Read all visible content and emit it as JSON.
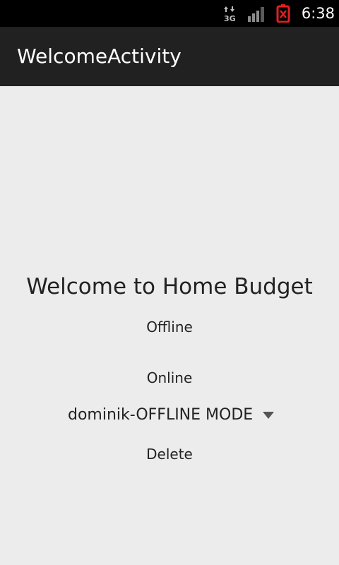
{
  "status_bar": {
    "network_icon": "3g-data-icon",
    "signal_icon": "signal-strength-icon",
    "battery_icon": "battery-empty-icon",
    "battery_color": "#e02020",
    "time": "6:38"
  },
  "action_bar": {
    "title": "WelcomeActivity",
    "background": "#212121"
  },
  "main": {
    "welcome_text": "Welcome to Home Budget",
    "offline_button": "Offline",
    "online_button": "Online",
    "account_spinner": {
      "selected_value": "dominik-OFFLINE MODE",
      "icon": "dropdown-triangle-icon"
    },
    "delete_button": "Delete"
  }
}
